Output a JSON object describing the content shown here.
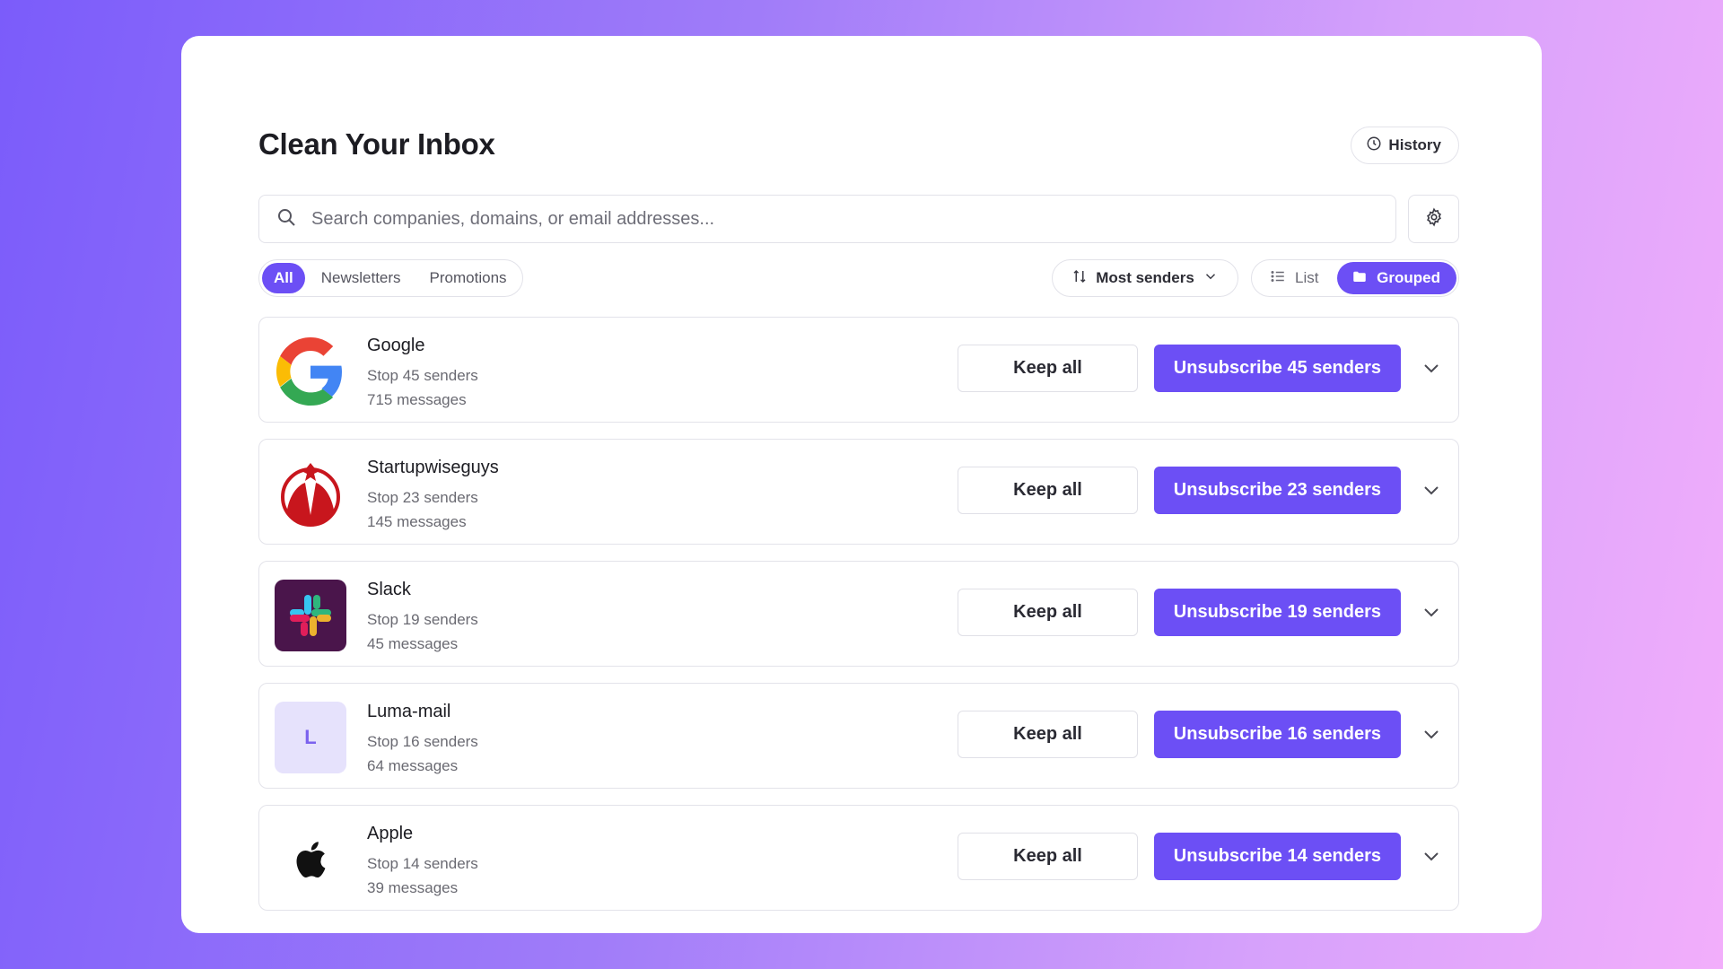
{
  "header": {
    "title": "Clean Your Inbox",
    "history_label": "History",
    "history_icon": "clock-icon",
    "settings_icon": "gear-icon"
  },
  "search": {
    "placeholder": "Search companies, domains, or email addresses...",
    "value": "",
    "icon": "search-icon"
  },
  "filters": {
    "items": [
      {
        "label": "All",
        "active": true
      },
      {
        "label": "Newsletters",
        "active": false
      },
      {
        "label": "Promotions",
        "active": false
      }
    ]
  },
  "sort": {
    "label": "Most senders",
    "icon": "sort-arrows-icon"
  },
  "view": {
    "list_label": "List",
    "grouped_label": "Grouped",
    "active": "Grouped"
  },
  "groups": [
    {
      "name": "Google",
      "senders": "Stop 45 senders",
      "messages": "715 messages",
      "keep_label": "Keep all",
      "unsub_label": "Unsubscribe 45 senders",
      "logo": "google-logo"
    },
    {
      "name": "Startupwiseguys",
      "senders": "Stop 23 senders",
      "messages": "145 messages",
      "keep_label": "Keep all",
      "unsub_label": "Unsubscribe 23 senders",
      "logo": "startupwiseguys-logo"
    },
    {
      "name": "Slack",
      "senders": "Stop 19 senders",
      "messages": "45 messages",
      "keep_label": "Keep all",
      "unsub_label": "Unsubscribe 19 senders",
      "logo": "slack-logo"
    },
    {
      "name": "Luma-mail",
      "senders": "Stop 16 senders",
      "messages": "64 messages",
      "keep_label": "Keep all",
      "unsub_label": "Unsubscribe 16 senders",
      "logo": "luma-letter-avatar",
      "logo_letter": "L"
    },
    {
      "name": "Apple",
      "senders": "Stop 14 senders",
      "messages": "39 messages",
      "keep_label": "Keep all",
      "unsub_label": "Unsubscribe 14 senders",
      "logo": "apple-logo"
    }
  ],
  "colors": {
    "accent": "#6c4ff5",
    "border": "#e3e3ea",
    "text_secondary": "#6a6a72"
  }
}
